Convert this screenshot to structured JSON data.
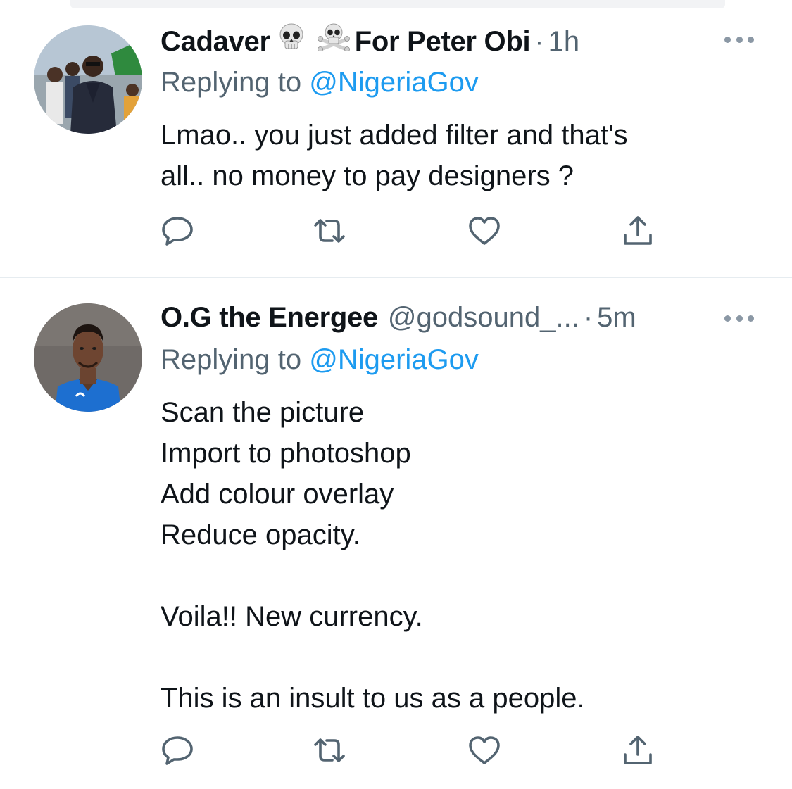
{
  "tweets": [
    {
      "display_name": "Cadaver",
      "name_emojis": [
        "skull-emoji",
        "skull-and-crossbones-emoji"
      ],
      "display_name_suffix": "For Peter Obi",
      "handle": "",
      "separator": "·",
      "time": "1h",
      "replying_prefix": "Replying to ",
      "replying_to": "@NigeriaGov",
      "body_lines": [
        "Lmao.. you just added filter and that's",
        "all.. no money to pay designers ?"
      ]
    },
    {
      "display_name": "O.G the Energee",
      "handle": "@godsound_...",
      "separator": "·",
      "time": "5m",
      "replying_prefix": "Replying to ",
      "replying_to": "@NigeriaGov",
      "body_lines": [
        "Scan the picture",
        "Import to photoshop",
        "Add colour overlay",
        "Reduce opacity.",
        "",
        "Voila!! New currency.",
        "",
        "This is an insult to us as a people."
      ]
    }
  ],
  "action_icons": [
    "reply-icon",
    "retweet-icon",
    "like-icon",
    "share-icon"
  ],
  "colors": {
    "text": "#0f1419",
    "secondary": "#536471",
    "link": "#1d9bf0",
    "icon": "#536471",
    "divider": "#e6ecf0"
  }
}
